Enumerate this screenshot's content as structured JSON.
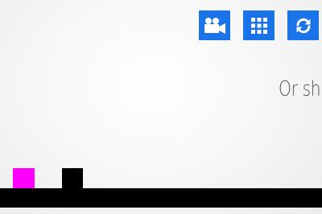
{
  "toolbar": {
    "buttons": [
      {
        "icon": "video-camera-icon",
        "color": "#1a73e8"
      },
      {
        "icon": "grid-icon",
        "color": "#1a73e8"
      },
      {
        "icon": "refresh-icon",
        "color": "#1a73e8"
      }
    ]
  },
  "hint": {
    "text": "Or sh"
  },
  "game": {
    "player_color": "#ff00ff",
    "obstacle_color": "#000000",
    "ground_color": "#000000"
  }
}
